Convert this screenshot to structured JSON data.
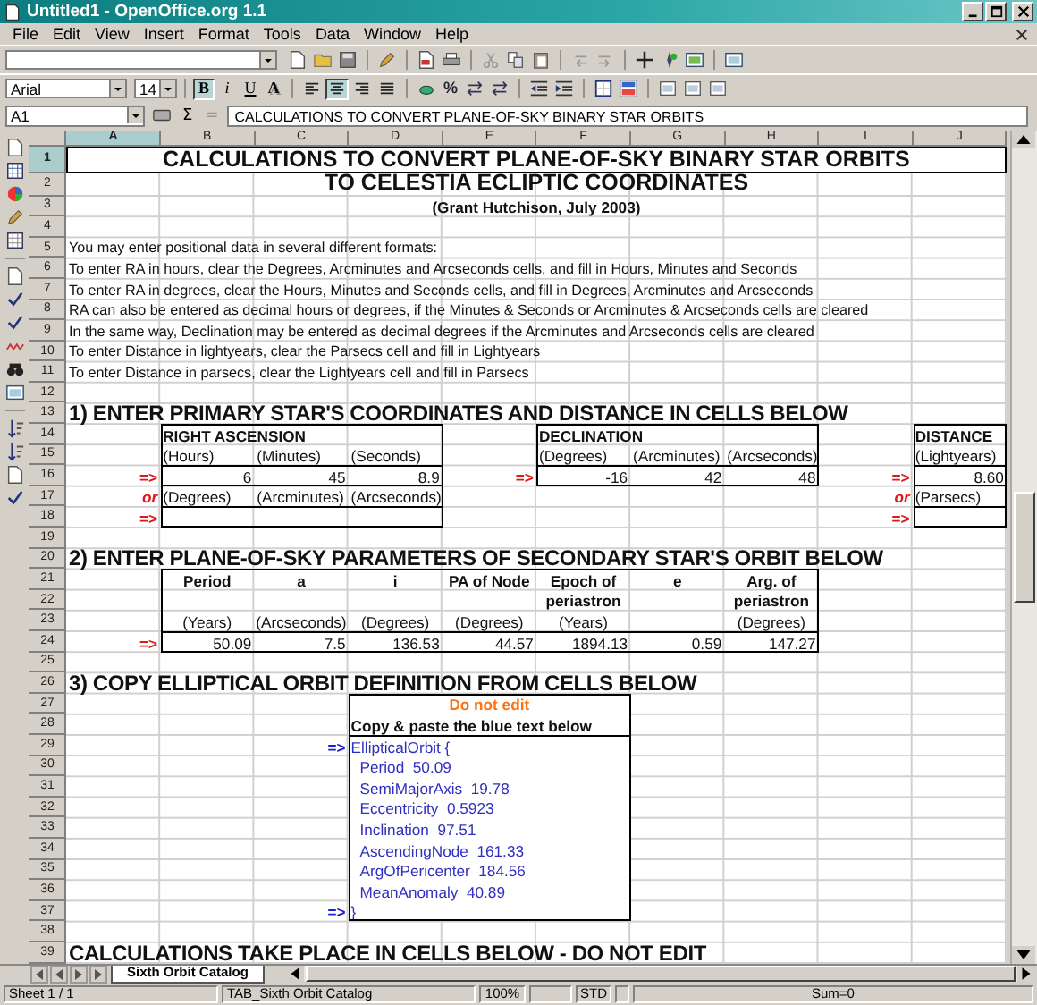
{
  "window": {
    "title": "Untitled1 - OpenOffice.org 1.1"
  },
  "menu": [
    {
      "label": "File"
    },
    {
      "label": "Edit"
    },
    {
      "label": "View"
    },
    {
      "label": "Insert"
    },
    {
      "label": "Format"
    },
    {
      "label": "Tools"
    },
    {
      "label": "Data"
    },
    {
      "label": "Window"
    },
    {
      "label": "Help"
    }
  ],
  "format_bar": {
    "font": "Arial",
    "size": "14",
    "style_buttons": [
      {
        "label": "B",
        "selected": true
      },
      {
        "label": "i",
        "selected": false
      },
      {
        "label": "U",
        "selected": false
      },
      {
        "label": "A",
        "selected": false
      }
    ],
    "align_buttons": [
      {
        "selected": false
      },
      {
        "selected": true
      },
      {
        "selected": false
      },
      {
        "selected": false
      }
    ],
    "number_buttons": [
      {
        "label": "%"
      }
    ]
  },
  "formula_bar": {
    "cell_ref": "A1",
    "buttons": [
      {
        "label": "Σ"
      },
      {
        "label": "="
      }
    ],
    "content": "CALCULATIONS TO CONVERT PLANE-OF-SKY BINARY STAR ORBITS"
  },
  "columns": [
    {
      "label": "A",
      "selected": true
    },
    {
      "label": "B",
      "selected": false
    },
    {
      "label": "C",
      "selected": false
    },
    {
      "label": "D",
      "selected": false
    },
    {
      "label": "E",
      "selected": false
    },
    {
      "label": "F",
      "selected": false
    },
    {
      "label": "G",
      "selected": false
    },
    {
      "label": "H",
      "selected": false
    },
    {
      "label": "I",
      "selected": false
    },
    {
      "label": "J",
      "selected": false
    }
  ],
  "rows": [
    {
      "number": "1",
      "selected": true,
      "cells": {
        "A": {
          "kind": "title",
          "text": "CALCULATIONS TO CONVERT PLANE-OF-SKY BINARY STAR ORBITS"
        }
      }
    },
    {
      "number": "2",
      "selected": false,
      "cells": {
        "A": {
          "kind": "subtitle",
          "text": "TO CELESTIA ECLIPTIC COORDINATES"
        }
      }
    },
    {
      "number": "3",
      "selected": false,
      "cells": {
        "A": {
          "kind": "byline",
          "text": "(Grant Hutchison, July 2003)"
        }
      }
    },
    {
      "number": "4",
      "selected": false
    },
    {
      "number": "5",
      "selected": false,
      "cells": {
        "A": {
          "kind": "note",
          "text": "You may enter positional data in several different formats:"
        }
      }
    },
    {
      "number": "6",
      "selected": false,
      "cells": {
        "A": {
          "kind": "note",
          "text": "To enter RA in hours, clear the Degrees, Arcminutes and Arcseconds cells, and fill in Hours, Minutes and Seconds"
        }
      }
    },
    {
      "number": "7",
      "selected": false,
      "cells": {
        "A": {
          "kind": "note",
          "text": "To enter RA in degrees, clear the Hours, Minutes and Seconds cells, and fill in Degrees, Arcminutes and Arcseconds"
        }
      }
    },
    {
      "number": "8",
      "selected": false,
      "cells": {
        "A": {
          "kind": "note",
          "text": "RA can also be entered as decimal hours or degrees, if the Minutes & Seconds or Arcminutes & Arcseconds cells are cleared"
        }
      }
    },
    {
      "number": "9",
      "selected": false,
      "cells": {
        "A": {
          "kind": "note",
          "text": "In the same way, Declination may be entered as decimal degrees if the Arcminutes and Arcseconds cells are cleared"
        }
      }
    },
    {
      "number": "10",
      "selected": false,
      "cells": {
        "A": {
          "kind": "note",
          "text": "To enter Distance in lightyears, clear the Parsecs cell and fill in Lightyears"
        }
      }
    },
    {
      "number": "11",
      "selected": false,
      "cells": {
        "A": {
          "kind": "note",
          "text": "To enter Distance in parsecs, clear the Lightyears cell and fill in Parsecs"
        }
      }
    },
    {
      "number": "12",
      "selected": false
    },
    {
      "number": "13",
      "selected": false,
      "cells": {
        "A": {
          "kind": "heading",
          "text": "1) ENTER PRIMARY STAR'S COORDINATES AND DISTANCE IN CELLS BELOW"
        }
      }
    },
    {
      "number": "14",
      "selected": false,
      "cells": {
        "B": {
          "kind": "group",
          "text": "RIGHT ASCENSION"
        },
        "F": {
          "kind": "group",
          "text": "DECLINATION"
        },
        "J": {
          "kind": "group",
          "text": "DISTANCE"
        }
      }
    },
    {
      "number": "15",
      "selected": false,
      "cells": {
        "B": {
          "kind": "label",
          "text": "(Hours)"
        },
        "C": {
          "kind": "label",
          "text": "(Minutes)"
        },
        "D": {
          "kind": "label",
          "text": "(Seconds)"
        },
        "F": {
          "kind": "label",
          "text": "(Degrees)"
        },
        "G": {
          "kind": "label",
          "text": "(Arcminutes)"
        },
        "H": {
          "kind": "label",
          "text": "(Arcseconds)"
        },
        "J": {
          "kind": "label",
          "text": "(Lightyears)"
        }
      }
    },
    {
      "number": "16",
      "selected": false,
      "cells": {
        "A": {
          "kind": "arrow",
          "text": "=>"
        },
        "B": {
          "kind": "value",
          "text": "6"
        },
        "C": {
          "kind": "value",
          "text": "45"
        },
        "D": {
          "kind": "value",
          "text": "8.9"
        },
        "E": {
          "kind": "arrow",
          "text": "=>"
        },
        "F": {
          "kind": "value",
          "text": "-16"
        },
        "G": {
          "kind": "value",
          "text": "42"
        },
        "H": {
          "kind": "value",
          "text": "48"
        },
        "I": {
          "kind": "arrow",
          "text": "=>"
        },
        "J": {
          "kind": "value",
          "text": "8.60"
        }
      }
    },
    {
      "number": "17",
      "selected": false,
      "cells": {
        "A": {
          "kind": "or",
          "text": "or"
        },
        "B": {
          "kind": "label",
          "text": "(Degrees)"
        },
        "C": {
          "kind": "label",
          "text": "(Arcminutes)"
        },
        "D": {
          "kind": "label",
          "text": "(Arcseconds)"
        },
        "I": {
          "kind": "or",
          "text": "or"
        },
        "J": {
          "kind": "label",
          "text": "(Parsecs)"
        }
      }
    },
    {
      "number": "18",
      "selected": false,
      "cells": {
        "A": {
          "kind": "arrow",
          "text": "=>"
        },
        "I": {
          "kind": "arrow",
          "text": "=>"
        }
      }
    },
    {
      "number": "19",
      "selected": false
    },
    {
      "number": "20",
      "selected": false,
      "cells": {
        "A": {
          "kind": "heading",
          "text": "2) ENTER PLANE-OF-SKY PARAMETERS OF SECONDARY STAR'S ORBIT BELOW"
        }
      }
    },
    {
      "number": "21",
      "selected": false,
      "cells": {
        "B": {
          "kind": "header",
          "text": "Period"
        },
        "C": {
          "kind": "header",
          "text": "a"
        },
        "D": {
          "kind": "header",
          "text": "i"
        },
        "E": {
          "kind": "header",
          "text": "PA of Node"
        },
        "F": {
          "kind": "header",
          "text": "Epoch of"
        },
        "G": {
          "kind": "header",
          "text": "e"
        },
        "H": {
          "kind": "header",
          "text": "Arg. of"
        }
      }
    },
    {
      "number": "22",
      "selected": false,
      "cells": {
        "F": {
          "kind": "header",
          "text": "periastron"
        },
        "H": {
          "kind": "header",
          "text": "periastron"
        }
      }
    },
    {
      "number": "23",
      "selected": false,
      "cells": {
        "B": {
          "kind": "unit",
          "text": "(Years)"
        },
        "C": {
          "kind": "unit",
          "text": "(Arcseconds)"
        },
        "D": {
          "kind": "unit",
          "text": "(Degrees)"
        },
        "E": {
          "kind": "unit",
          "text": "(Degrees)"
        },
        "F": {
          "kind": "unit",
          "text": "(Years)"
        },
        "H": {
          "kind": "unit",
          "text": "(Degrees)"
        }
      }
    },
    {
      "number": "24",
      "selected": false,
      "cells": {
        "A": {
          "kind": "arrow",
          "text": "=>"
        },
        "B": {
          "kind": "value",
          "text": "50.09"
        },
        "C": {
          "kind": "value",
          "text": "7.5"
        },
        "D": {
          "kind": "value",
          "text": "136.53"
        },
        "E": {
          "kind": "value",
          "text": "44.57"
        },
        "F": {
          "kind": "value",
          "text": "1894.13"
        },
        "G": {
          "kind": "value",
          "text": "0.59"
        },
        "H": {
          "kind": "value",
          "text": "147.27"
        }
      }
    },
    {
      "number": "25",
      "selected": false
    },
    {
      "number": "26",
      "selected": false,
      "cells": {
        "A": {
          "kind": "heading",
          "text": "3) COPY ELLIPTICAL ORBIT DEFINITION FROM CELLS BELOW"
        }
      }
    },
    {
      "number": "27",
      "selected": false,
      "cells": {
        "D": {
          "kind": "notice",
          "text": "Do not edit"
        }
      }
    },
    {
      "number": "28",
      "selected": false,
      "cells": {
        "D": {
          "kind": "instruction",
          "text": "Copy & paste the blue text below"
        }
      }
    },
    {
      "number": "29",
      "selected": false,
      "cells": {
        "C": {
          "kind": "pointer",
          "text": "=>"
        },
        "D": {
          "kind": "code",
          "text": "EllipticalOrbit {"
        }
      }
    },
    {
      "number": "30",
      "selected": false,
      "cells": {
        "D": {
          "kind": "code_entry",
          "text": "Period  50.09"
        }
      }
    },
    {
      "number": "31",
      "selected": false,
      "cells": {
        "D": {
          "kind": "code_entry",
          "text": "SemiMajorAxis  19.78"
        }
      }
    },
    {
      "number": "32",
      "selected": false,
      "cells": {
        "D": {
          "kind": "code_entry",
          "text": "Eccentricity  0.5923"
        }
      }
    },
    {
      "number": "33",
      "selected": false,
      "cells": {
        "D": {
          "kind": "code_entry",
          "text": "Inclination  97.51"
        }
      }
    },
    {
      "number": "34",
      "selected": false,
      "cells": {
        "D": {
          "kind": "code_entry",
          "text": "AscendingNode  161.33"
        }
      }
    },
    {
      "number": "35",
      "selected": false,
      "cells": {
        "D": {
          "kind": "code_entry",
          "text": "ArgOfPericenter  184.56"
        }
      }
    },
    {
      "number": "36",
      "selected": false,
      "cells": {
        "D": {
          "kind": "code_entry",
          "text": "MeanAnomaly  40.89"
        }
      }
    },
    {
      "number": "37",
      "selected": false,
      "cells": {
        "C": {
          "kind": "pointer",
          "text": "=>"
        },
        "D": {
          "kind": "code",
          "text": "}"
        }
      }
    },
    {
      "number": "38",
      "selected": false
    },
    {
      "number": "39",
      "selected": false,
      "cells": {
        "A": {
          "kind": "heading",
          "text": "CALCULATIONS TAKE PLACE IN CELLS BELOW - DO NOT EDIT"
        }
      }
    }
  ],
  "sheet_tabs": [
    {
      "label": "Sixth Orbit Catalog",
      "selected": true
    }
  ],
  "status_bar": {
    "sheet": "Sheet 1 / 1",
    "page_style": "TAB_Sixth Orbit Catalog",
    "zoom": "100%",
    "mode": "STD",
    "sum": "Sum=0"
  }
}
